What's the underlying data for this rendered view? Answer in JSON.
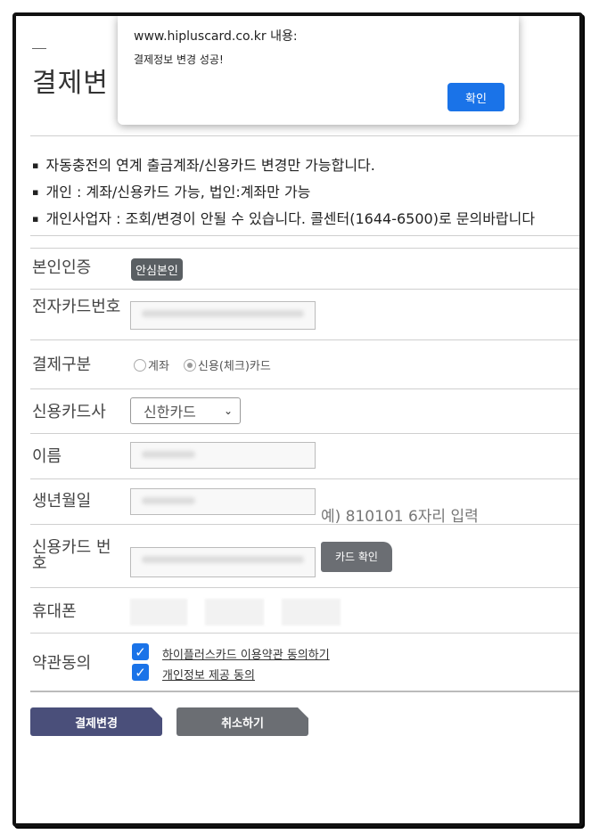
{
  "page": {
    "title": "결제변",
    "notices": [
      "자동충전의 연계 출금계좌/신용카드 변경만 가능합니다.",
      "개인 : 계좌/신용카드 가능, 법인:계좌만 가능",
      "개인사업자 : 조회/변경이 안될 수 있습니다. 콜센터(1644-6500)로 문의바랍니다"
    ]
  },
  "form": {
    "auth_label": "본인인증",
    "auth_badge": "안심본인",
    "card_number_label": "전자카드번호",
    "payment_type_label": "결제구분",
    "payment_type_options": [
      "계좌",
      "신용(체크)카드"
    ],
    "payment_type_selected": "신용(체크)카드",
    "card_company_label": "신용카드사",
    "card_company_value": "신한카드",
    "name_label": "이름",
    "birth_label": "생년월일",
    "birth_hint": "예) 810101 6자리 입력",
    "credit_card_label": "신용카드 번호",
    "card_check_button": "카드 확인",
    "phone_label": "휴대폰",
    "terms_label": "약관동의",
    "terms": [
      {
        "text": "하이플러스카드 이용약관 동의하기",
        "checked": true
      },
      {
        "text": "개인정보 제공 동의",
        "checked": true
      }
    ]
  },
  "buttons": {
    "submit": "결제변경",
    "cancel": "취소하기"
  },
  "dialog": {
    "title": "www.hipluscard.co.kr 내용:",
    "message": "결제정보 변경 성공!",
    "ok": "확인"
  },
  "colors": {
    "primary_button": "#4a4f7a",
    "secondary_button": "#6b6e73",
    "dialog_ok": "#1a73e8",
    "checkbox": "#1a73e8"
  }
}
